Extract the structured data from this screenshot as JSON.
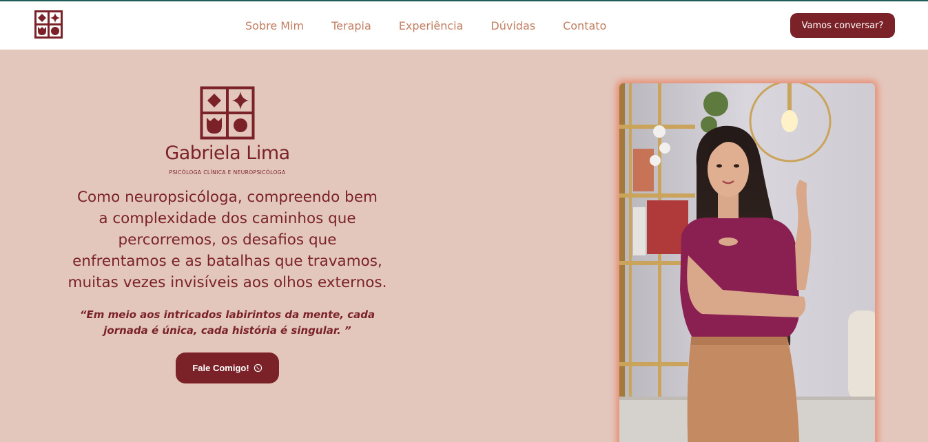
{
  "nav": {
    "logo_icon": "brand-mark-icon",
    "links": [
      {
        "label": "Sobre Mim"
      },
      {
        "label": "Terapia"
      },
      {
        "label": "Experiência"
      },
      {
        "label": "Dúvidas"
      },
      {
        "label": "Contato"
      }
    ],
    "cta_label": "Vamos conversar?"
  },
  "hero": {
    "brand_name": "Gabriela Lima",
    "brand_subtitle": "PSICÓLOGA CLÍNICA E NEUROPSICÓLOGA",
    "lead_lines": [
      "Como neuropsicóloga, compreendo bem",
      "a complexidade dos caminhos que",
      "percorremos, os desafios que",
      "enfrentamos e as batalhas que travamos,",
      "muitas vezes invisíveis aos olhos externos."
    ],
    "quote_lines": [
      "“Em meio aos intricados labirintos da mente, cada",
      "jornada é única, cada história é singular. ”"
    ],
    "cta_label": "Fale Comigo!",
    "cta_icon": "whatsapp-icon",
    "photo_icon": "portrait-photo"
  },
  "colors": {
    "brand": "#7a2228",
    "nav_link": "#c27e61",
    "background": "#e3c7bd",
    "accent_line": "#1f5d58",
    "photo_glow": "#e8896e"
  }
}
